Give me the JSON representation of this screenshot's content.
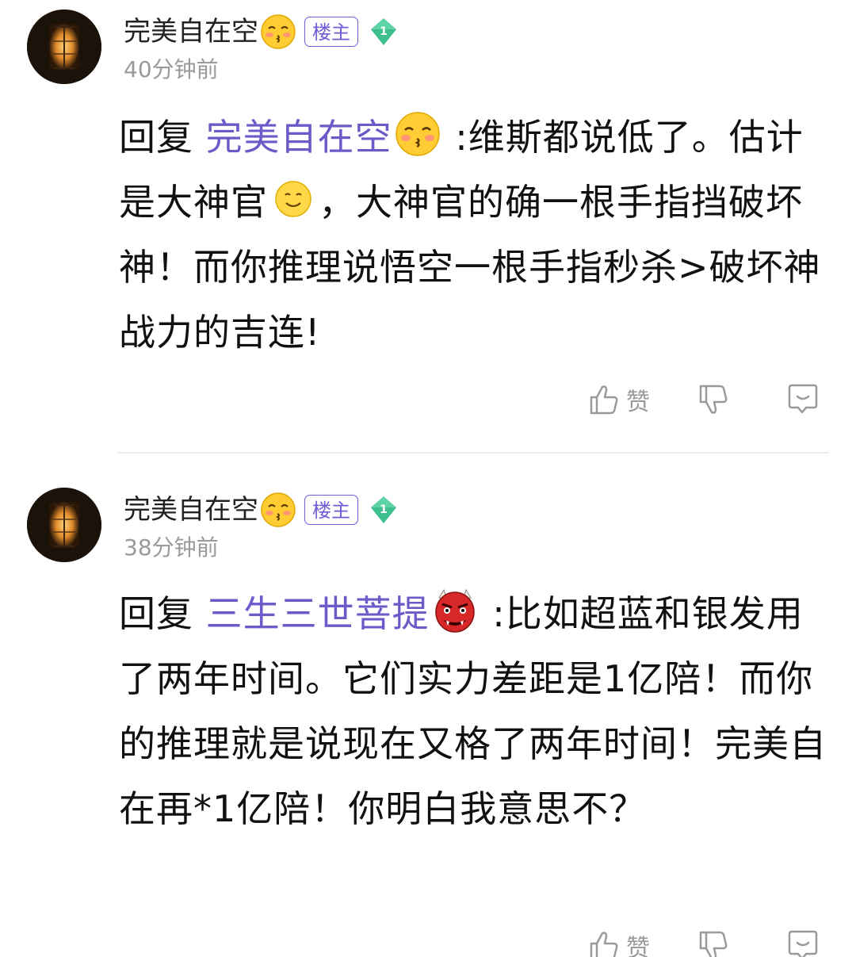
{
  "comments": [
    {
      "username": "完美自在空",
      "owner_badge": "楼主",
      "level": "1",
      "time": "40分钟前",
      "reply_prefix": "回复 ",
      "reply_to": "完美自在空",
      "reply_to_emoji": "kissing-face-emoji",
      "text_part1": " :维斯都说低了。估计是大神官",
      "inline_emoji": "smiling-face-emoji",
      "text_part2": "，大神官的确一根手指挡破坏神！而你推理说悟空一根手指秒杀>破坏神战力的吉连!",
      "like_label": "赞"
    },
    {
      "username": "完美自在空",
      "owner_badge": "楼主",
      "level": "1",
      "time": "38分钟前",
      "reply_prefix": "回复 ",
      "reply_to": "三生三世菩提",
      "reply_to_emoji": "red-ogre-emoji",
      "text_part1": " :比如超蓝和银发用了两年时间。它们实力差距是1亿陪！而你的推理就是说现在又格了两年时间！完美自在再*1亿陪！你明白我意思不？",
      "like_label": "赞"
    }
  ],
  "colors": {
    "link": "#6a5bc9",
    "badge": "#6d5dd6",
    "level_badge": "#5fd3a8",
    "meta_gray": "#9a9a9a"
  }
}
